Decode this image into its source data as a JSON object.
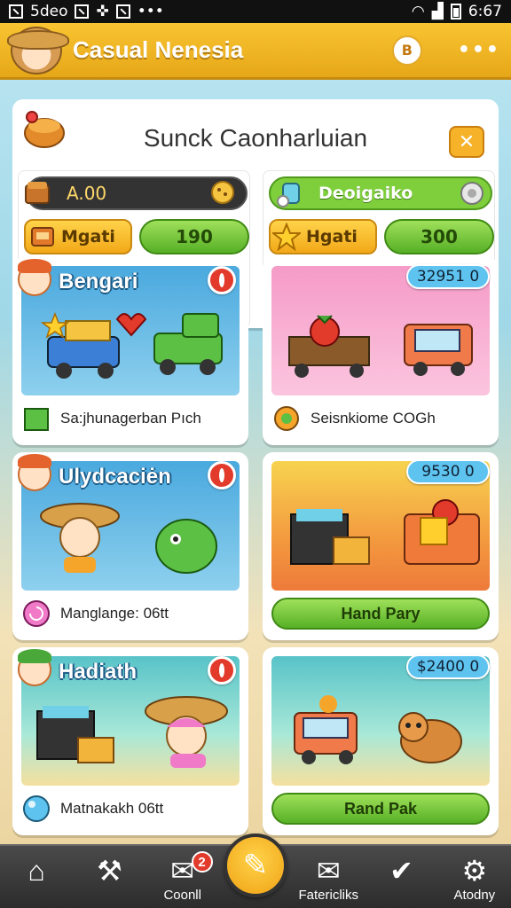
{
  "status_bar": {
    "left_text": "5deo",
    "time": "6:67"
  },
  "header": {
    "title": "Casual Nenesia",
    "coin_label": "B",
    "more_label": "•••"
  },
  "panel": {
    "title": "Sunck Caonharluian",
    "close_label": "✕",
    "left": {
      "balance": "A.00",
      "label": "Mgati",
      "value": "190"
    },
    "right": {
      "name": "Deoigaiko",
      "label": "Hgati",
      "value": "300"
    }
  },
  "cards": [
    {
      "title": "Bengari",
      "footer": "Sa:jhunagerban Pıch"
    },
    {
      "price": "32951 0",
      "footer": "Seisnkiome COGh"
    },
    {
      "title": "Ulydcaciėn",
      "footer": "Manglange: 06tt"
    },
    {
      "price": "9530 0",
      "button": "Hand Pary"
    },
    {
      "title": "Hadiath",
      "footer": "Matnakakh 06tt"
    },
    {
      "price": "$2400 0",
      "button": "Rand Pak"
    }
  ],
  "nav": {
    "items": [
      "",
      "",
      "Coonll",
      "",
      "Fatericliks",
      "",
      "Atodny"
    ],
    "badge": "2"
  },
  "colors": {
    "header": "#f9c431",
    "accent_green": "#7ecf3b",
    "badge_red": "#e23a2b",
    "price_blue": "#5ec3ef"
  }
}
